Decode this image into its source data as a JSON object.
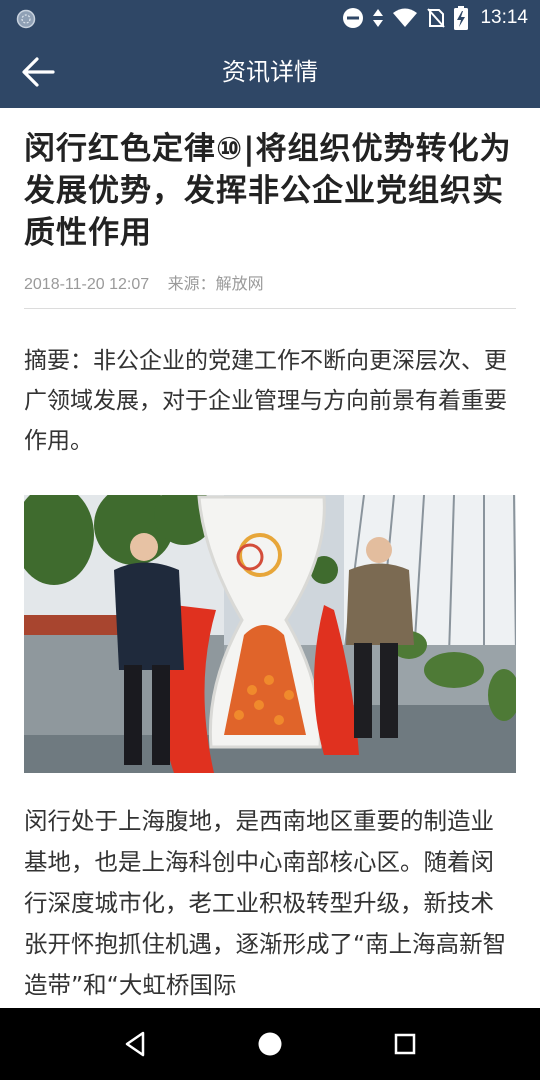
{
  "status_bar": {
    "time": "13:14"
  },
  "header": {
    "title": "资讯详情"
  },
  "article": {
    "title": "闵行红色定律⑩|将组织优势转化为发展优势，发挥非公企业党组织实质性作用",
    "date": "2018-11-20 12:07",
    "source": "来源：解放网",
    "summary": "摘要：非公企业的党建工作不断向更深层次、更广领域发展，对于企业管理与方向前景有着重要作用。",
    "body": "闵行处于上海腹地，是西南地区重要的制造业基地，也是上海科创中心南部核心区。随着闵行深度城市化，老工业积极转型升级，新技术张开怀抱抓住机遇，逐渐形成了“南上海高新智造带”和“大虹桥国际"
  },
  "icons": {
    "back": "arrow-left-icon",
    "nav_back": "triangle-back-icon",
    "nav_home": "circle-home-icon",
    "nav_recents": "square-recents-icon"
  },
  "colors": {
    "header_bg": "#2f4766",
    "nav_bg": "#000000"
  }
}
